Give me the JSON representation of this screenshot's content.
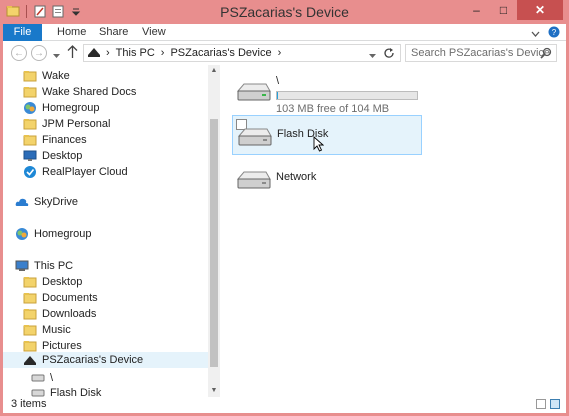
{
  "window": {
    "title": "PSZacarias's Device"
  },
  "quick_access": [
    "properties-icon",
    "new-folder-icon",
    "customize-icon"
  ],
  "window_controls": {
    "minimize": "–",
    "maximize": "□",
    "close": "✕"
  },
  "ribbon": {
    "tabs": [
      "File",
      "Home",
      "Share",
      "View"
    ],
    "expand_icon": "chevron-down-icon",
    "help_icon": "help-icon"
  },
  "address": {
    "breadcrumb": [
      "This PC",
      "PSZacarias's Device"
    ],
    "search_placeholder": "Search PSZacarias's Device"
  },
  "nav_pane": {
    "quick": [
      {
        "label": "Wake",
        "icon": "folder-icon"
      },
      {
        "label": "Wake Shared Docs",
        "icon": "folder-icon"
      },
      {
        "label": "Homegroup",
        "icon": "homegroup-icon"
      },
      {
        "label": "JPM Personal",
        "icon": "folder-icon"
      },
      {
        "label": "Finances",
        "icon": "folder-icon"
      },
      {
        "label": "Desktop",
        "icon": "desktop-icon"
      },
      {
        "label": "RealPlayer Cloud",
        "icon": "cloud-icon"
      }
    ],
    "skydrive": "SkyDrive",
    "homegroup": "Homegroup",
    "this_pc": "This PC",
    "pc_items": [
      {
        "label": "Desktop",
        "icon": "folder-icon"
      },
      {
        "label": "Documents",
        "icon": "folder-icon"
      },
      {
        "label": "Downloads",
        "icon": "folder-icon"
      },
      {
        "label": "Music",
        "icon": "folder-icon"
      },
      {
        "label": "Pictures",
        "icon": "folder-icon"
      }
    ],
    "device": "PSZacarias's Device",
    "device_children": [
      "\\",
      "Flash Disk"
    ]
  },
  "content": {
    "items": [
      {
        "name": "\\",
        "free_text": "103 MB free of 104 MB",
        "used_fraction": 0.01
      },
      {
        "name": "Flash Disk"
      },
      {
        "name": "Network"
      }
    ]
  },
  "status": {
    "count": "3 items"
  },
  "colors": {
    "frame": "#e88e8e",
    "file_tab": "#1979ca",
    "selection": "#e5f3fb",
    "selection_border": "#99d1ff",
    "progress": "#26a0da"
  }
}
